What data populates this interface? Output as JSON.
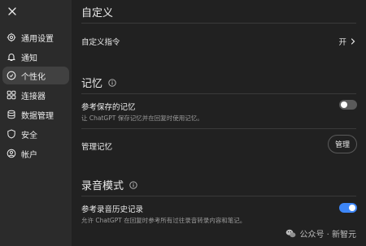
{
  "sidebar": {
    "items": [
      {
        "label": "通用设置",
        "icon": "gear-icon"
      },
      {
        "label": "通知",
        "icon": "bell-icon"
      },
      {
        "label": "个性化",
        "icon": "personalization-icon",
        "active": true
      },
      {
        "label": "连接器",
        "icon": "connector-icon"
      },
      {
        "label": "数据管理",
        "icon": "database-icon"
      },
      {
        "label": "安全",
        "icon": "shield-icon"
      },
      {
        "label": "帐户",
        "icon": "account-icon"
      }
    ]
  },
  "main": {
    "custom": {
      "title": "自定义",
      "instruction_label": "自定义指令",
      "instruction_value": "开"
    },
    "memory": {
      "title": "记忆",
      "saved_label": "参考保存的记忆",
      "saved_desc": "让 ChatGPT 保存记忆并在回复时使用记忆。",
      "saved_enabled": false,
      "manage_label": "管理记忆",
      "manage_button": "管理"
    },
    "recording": {
      "title": "录音模式",
      "history_label": "参考录音历史记录",
      "history_desc": "允许 ChatGPT 在回复时参考所有过往录音转录内容和笔记。",
      "history_enabled": true
    }
  },
  "watermark": {
    "text": "公众号 · 新智元"
  },
  "colors": {
    "background": "#212121",
    "sidebar": "#2b2b2b",
    "accent": "#3d86f7"
  }
}
